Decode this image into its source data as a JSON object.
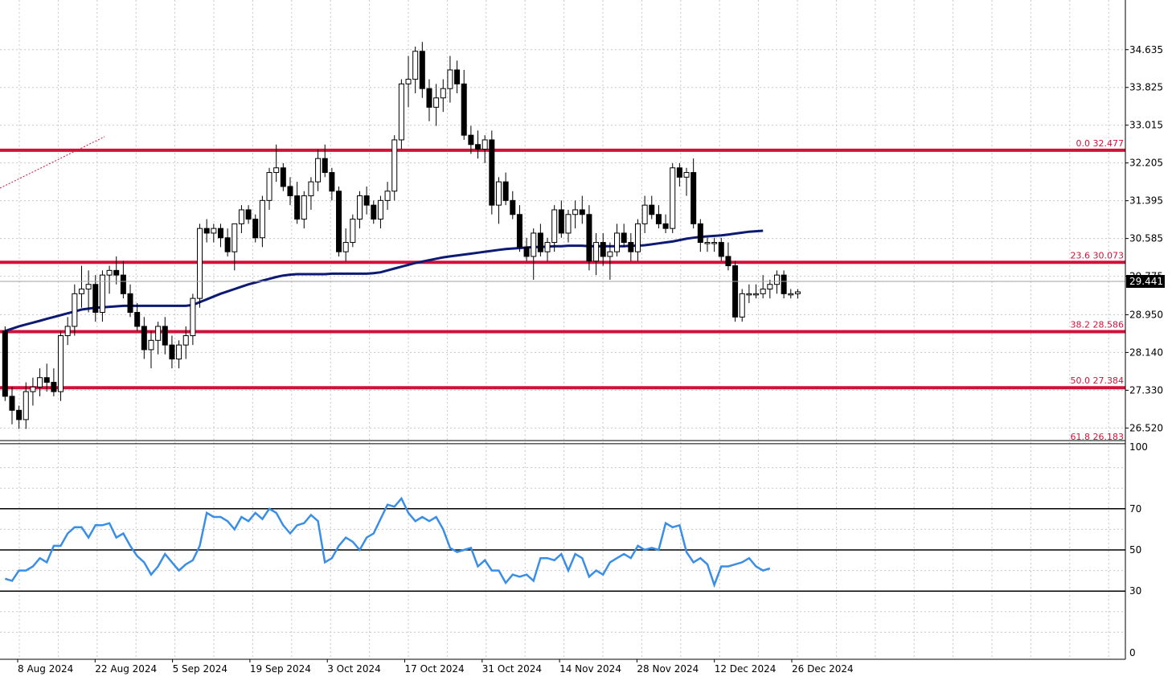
{
  "colors": {
    "background": "#ffffff",
    "grid": "#c8c8c8",
    "candle_up": "#ffffff",
    "candle_down": "#000000",
    "candle_outline": "#000000",
    "fib_line": "#d0123a",
    "moving_average": "#0c1a73",
    "rsi_line": "#3a8ee6",
    "rsi_levels": "#000000",
    "price_label_bg": "#000000",
    "price_label_text": "#ffffff",
    "axis_text": "#000000"
  },
  "chart_data": [
    {
      "type": "candlestick",
      "panel": "price",
      "price_axis_ticks": [
        "34.635",
        "33.825",
        "33.015",
        "32.205",
        "31.395",
        "30.585",
        "29.775",
        "28.950",
        "28.140",
        "27.330",
        "26.520"
      ],
      "ylim": [
        26.25,
        35.7
      ],
      "current_price": "29.441",
      "grid": true,
      "fibonacci_levels": [
        {
          "label": "0.0 32.477",
          "value": 32.477
        },
        {
          "label": "23.6 30.073",
          "value": 30.073
        },
        {
          "label": "38.2 28.586",
          "value": 28.586
        },
        {
          "label": "50.0 27.384",
          "value": 27.384
        },
        {
          "label": "61.8 26.183",
          "value": 26.183
        }
      ],
      "candles": [
        {
          "o": 28.6,
          "h": 28.7,
          "l": 27.1,
          "c": 27.2
        },
        {
          "o": 27.2,
          "h": 27.4,
          "l": 26.6,
          "c": 26.9
        },
        {
          "o": 26.9,
          "h": 27.0,
          "l": 26.5,
          "c": 26.7
        },
        {
          "o": 26.7,
          "h": 27.5,
          "l": 26.5,
          "c": 27.3
        },
        {
          "o": 27.3,
          "h": 27.6,
          "l": 27.0,
          "c": 27.4
        },
        {
          "o": 27.4,
          "h": 27.8,
          "l": 27.2,
          "c": 27.6
        },
        {
          "o": 27.6,
          "h": 27.9,
          "l": 27.3,
          "c": 27.5
        },
        {
          "o": 27.5,
          "h": 27.8,
          "l": 27.2,
          "c": 27.3
        },
        {
          "o": 27.3,
          "h": 28.6,
          "l": 27.1,
          "c": 28.5
        },
        {
          "o": 28.5,
          "h": 28.9,
          "l": 28.3,
          "c": 28.7
        },
        {
          "o": 28.7,
          "h": 29.6,
          "l": 28.5,
          "c": 29.4
        },
        {
          "o": 29.4,
          "h": 30.0,
          "l": 29.1,
          "c": 29.5
        },
        {
          "o": 29.5,
          "h": 29.9,
          "l": 29.0,
          "c": 29.6
        },
        {
          "o": 29.6,
          "h": 29.8,
          "l": 28.8,
          "c": 29.0
        },
        {
          "o": 29.0,
          "h": 29.9,
          "l": 28.8,
          "c": 29.8
        },
        {
          "o": 29.8,
          "h": 30.0,
          "l": 29.4,
          "c": 29.9
        },
        {
          "o": 29.9,
          "h": 30.2,
          "l": 29.6,
          "c": 29.8
        },
        {
          "o": 29.8,
          "h": 30.1,
          "l": 29.3,
          "c": 29.4
        },
        {
          "o": 29.4,
          "h": 29.6,
          "l": 28.9,
          "c": 29.0
        },
        {
          "o": 29.0,
          "h": 29.2,
          "l": 28.6,
          "c": 28.7
        },
        {
          "o": 28.7,
          "h": 28.9,
          "l": 28.0,
          "c": 28.2
        },
        {
          "o": 28.2,
          "h": 28.6,
          "l": 27.8,
          "c": 28.4
        },
        {
          "o": 28.4,
          "h": 28.8,
          "l": 28.1,
          "c": 28.7
        },
        {
          "o": 28.7,
          "h": 28.9,
          "l": 28.1,
          "c": 28.3
        },
        {
          "o": 28.3,
          "h": 28.5,
          "l": 27.8,
          "c": 28.0
        },
        {
          "o": 28.0,
          "h": 28.4,
          "l": 27.8,
          "c": 28.3
        },
        {
          "o": 28.3,
          "h": 28.7,
          "l": 28.0,
          "c": 28.5
        },
        {
          "o": 28.5,
          "h": 29.4,
          "l": 28.3,
          "c": 29.3
        },
        {
          "o": 29.3,
          "h": 30.9,
          "l": 29.1,
          "c": 30.8
        },
        {
          "o": 30.8,
          "h": 31.0,
          "l": 30.5,
          "c": 30.7
        },
        {
          "o": 30.7,
          "h": 30.9,
          "l": 30.5,
          "c": 30.8
        },
        {
          "o": 30.8,
          "h": 30.9,
          "l": 30.4,
          "c": 30.6
        },
        {
          "o": 30.6,
          "h": 30.8,
          "l": 30.2,
          "c": 30.3
        },
        {
          "o": 30.3,
          "h": 30.9,
          "l": 29.9,
          "c": 30.9
        },
        {
          "o": 30.9,
          "h": 31.3,
          "l": 30.7,
          "c": 31.2
        },
        {
          "o": 31.2,
          "h": 31.3,
          "l": 30.9,
          "c": 31.0
        },
        {
          "o": 31.0,
          "h": 31.1,
          "l": 30.5,
          "c": 30.6
        },
        {
          "o": 30.6,
          "h": 31.5,
          "l": 30.4,
          "c": 31.4
        },
        {
          "o": 31.4,
          "h": 32.1,
          "l": 31.2,
          "c": 32.0
        },
        {
          "o": 32.0,
          "h": 32.6,
          "l": 31.8,
          "c": 32.1
        },
        {
          "o": 32.1,
          "h": 32.2,
          "l": 31.6,
          "c": 31.7
        },
        {
          "o": 31.7,
          "h": 31.9,
          "l": 31.3,
          "c": 31.5
        },
        {
          "o": 31.5,
          "h": 31.8,
          "l": 30.9,
          "c": 31.0
        },
        {
          "o": 31.0,
          "h": 31.6,
          "l": 30.8,
          "c": 31.5
        },
        {
          "o": 31.5,
          "h": 31.9,
          "l": 31.2,
          "c": 31.8
        },
        {
          "o": 31.8,
          "h": 32.5,
          "l": 31.6,
          "c": 32.3
        },
        {
          "o": 32.3,
          "h": 32.6,
          "l": 31.9,
          "c": 32.0
        },
        {
          "o": 32.0,
          "h": 32.1,
          "l": 31.4,
          "c": 31.6
        },
        {
          "o": 31.6,
          "h": 31.7,
          "l": 30.2,
          "c": 30.3
        },
        {
          "o": 30.3,
          "h": 30.8,
          "l": 30.1,
          "c": 30.5
        },
        {
          "o": 30.5,
          "h": 31.1,
          "l": 30.4,
          "c": 31.0
        },
        {
          "o": 31.0,
          "h": 31.6,
          "l": 30.8,
          "c": 31.5
        },
        {
          "o": 31.5,
          "h": 31.7,
          "l": 31.1,
          "c": 31.3
        },
        {
          "o": 31.3,
          "h": 31.4,
          "l": 30.9,
          "c": 31.0
        },
        {
          "o": 31.0,
          "h": 31.5,
          "l": 30.8,
          "c": 31.4
        },
        {
          "o": 31.4,
          "h": 31.8,
          "l": 31.2,
          "c": 31.6
        },
        {
          "o": 31.6,
          "h": 32.8,
          "l": 31.4,
          "c": 32.7
        },
        {
          "o": 32.7,
          "h": 34.0,
          "l": 32.5,
          "c": 33.9
        },
        {
          "o": 33.9,
          "h": 34.5,
          "l": 33.4,
          "c": 34.0
        },
        {
          "o": 34.0,
          "h": 34.7,
          "l": 33.7,
          "c": 34.6
        },
        {
          "o": 34.6,
          "h": 34.8,
          "l": 33.6,
          "c": 33.8
        },
        {
          "o": 33.8,
          "h": 34.0,
          "l": 33.1,
          "c": 33.4
        },
        {
          "o": 33.4,
          "h": 33.9,
          "l": 33.0,
          "c": 33.6
        },
        {
          "o": 33.6,
          "h": 34.0,
          "l": 33.3,
          "c": 33.8
        },
        {
          "o": 33.8,
          "h": 34.5,
          "l": 33.5,
          "c": 34.2
        },
        {
          "o": 34.2,
          "h": 34.4,
          "l": 33.7,
          "c": 33.9
        },
        {
          "o": 33.9,
          "h": 34.2,
          "l": 32.7,
          "c": 32.8
        },
        {
          "o": 32.8,
          "h": 33.0,
          "l": 32.4,
          "c": 32.6
        },
        {
          "o": 32.6,
          "h": 32.9,
          "l": 32.3,
          "c": 32.5
        },
        {
          "o": 32.5,
          "h": 32.8,
          "l": 32.2,
          "c": 32.7
        },
        {
          "o": 32.7,
          "h": 32.9,
          "l": 31.1,
          "c": 31.3
        },
        {
          "o": 31.3,
          "h": 31.9,
          "l": 30.9,
          "c": 31.8
        },
        {
          "o": 31.8,
          "h": 32.0,
          "l": 31.3,
          "c": 31.4
        },
        {
          "o": 31.4,
          "h": 31.6,
          "l": 31.0,
          "c": 31.1
        },
        {
          "o": 31.1,
          "h": 31.3,
          "l": 30.3,
          "c": 30.4
        },
        {
          "o": 30.4,
          "h": 30.6,
          "l": 30.1,
          "c": 30.2
        },
        {
          "o": 30.2,
          "h": 30.8,
          "l": 29.7,
          "c": 30.7
        },
        {
          "o": 30.7,
          "h": 30.9,
          "l": 30.2,
          "c": 30.3
        },
        {
          "o": 30.3,
          "h": 30.6,
          "l": 30.1,
          "c": 30.5
        },
        {
          "o": 30.5,
          "h": 31.3,
          "l": 30.3,
          "c": 31.2
        },
        {
          "o": 31.2,
          "h": 31.4,
          "l": 30.6,
          "c": 30.7
        },
        {
          "o": 30.7,
          "h": 31.2,
          "l": 30.5,
          "c": 31.1
        },
        {
          "o": 31.1,
          "h": 31.4,
          "l": 30.8,
          "c": 31.2
        },
        {
          "o": 31.2,
          "h": 31.5,
          "l": 30.9,
          "c": 31.1
        },
        {
          "o": 31.1,
          "h": 31.3,
          "l": 29.9,
          "c": 30.1
        },
        {
          "o": 30.1,
          "h": 30.7,
          "l": 29.8,
          "c": 30.5
        },
        {
          "o": 30.5,
          "h": 30.7,
          "l": 30.0,
          "c": 30.2
        },
        {
          "o": 30.2,
          "h": 30.5,
          "l": 29.7,
          "c": 30.3
        },
        {
          "o": 30.3,
          "h": 30.9,
          "l": 30.2,
          "c": 30.7
        },
        {
          "o": 30.7,
          "h": 30.9,
          "l": 30.4,
          "c": 30.5
        },
        {
          "o": 30.5,
          "h": 30.7,
          "l": 30.1,
          "c": 30.3
        },
        {
          "o": 30.3,
          "h": 31.0,
          "l": 30.1,
          "c": 30.9
        },
        {
          "o": 30.9,
          "h": 31.5,
          "l": 30.7,
          "c": 31.3
        },
        {
          "o": 31.3,
          "h": 31.5,
          "l": 31.0,
          "c": 31.1
        },
        {
          "o": 31.1,
          "h": 31.3,
          "l": 30.8,
          "c": 30.9
        },
        {
          "o": 30.9,
          "h": 31.1,
          "l": 30.7,
          "c": 30.8
        },
        {
          "o": 30.8,
          "h": 32.2,
          "l": 30.7,
          "c": 32.1
        },
        {
          "o": 32.1,
          "h": 32.2,
          "l": 31.7,
          "c": 31.9
        },
        {
          "o": 31.9,
          "h": 32.1,
          "l": 31.5,
          "c": 32.0
        },
        {
          "o": 32.0,
          "h": 32.3,
          "l": 30.8,
          "c": 30.9
        },
        {
          "o": 30.9,
          "h": 31.0,
          "l": 30.3,
          "c": 30.5
        },
        {
          "o": 30.5,
          "h": 30.6,
          "l": 30.3,
          "c": 30.5
        },
        {
          "o": 30.5,
          "h": 30.6,
          "l": 30.3,
          "c": 30.5
        },
        {
          "o": 30.5,
          "h": 30.6,
          "l": 30.1,
          "c": 30.2
        },
        {
          "o": 30.2,
          "h": 30.5,
          "l": 29.9,
          "c": 30.0
        },
        {
          "o": 30.0,
          "h": 30.1,
          "l": 28.8,
          "c": 28.9
        },
        {
          "o": 28.9,
          "h": 29.5,
          "l": 28.8,
          "c": 29.4
        },
        {
          "o": 29.4,
          "h": 29.6,
          "l": 29.2,
          "c": 29.4
        },
        {
          "o": 29.4,
          "h": 29.6,
          "l": 29.3,
          "c": 29.4
        },
        {
          "o": 29.4,
          "h": 29.8,
          "l": 29.3,
          "c": 29.5
        },
        {
          "o": 29.5,
          "h": 29.7,
          "l": 29.3,
          "c": 29.6
        },
        {
          "o": 29.6,
          "h": 29.9,
          "l": 29.4,
          "c": 29.8
        },
        {
          "o": 29.8,
          "h": 29.9,
          "l": 29.3,
          "c": 29.4
        },
        {
          "o": 29.4,
          "h": 29.5,
          "l": 29.3,
          "c": 29.4
        },
        {
          "o": 29.4,
          "h": 29.5,
          "l": 29.3,
          "c": 29.44
        }
      ],
      "moving_average": [
        28.6,
        28.65,
        28.7,
        28.74,
        28.78,
        28.82,
        28.86,
        28.9,
        28.94,
        28.98,
        29.02,
        29.06,
        29.08,
        29.1,
        29.11,
        29.12,
        29.13,
        29.14,
        29.14,
        29.14,
        29.14,
        29.14,
        29.14,
        29.14,
        29.14,
        29.14,
        29.14,
        29.16,
        29.22,
        29.28,
        29.34,
        29.4,
        29.45,
        29.5,
        29.55,
        29.6,
        29.64,
        29.68,
        29.72,
        29.76,
        29.79,
        29.81,
        29.82,
        29.82,
        29.82,
        29.82,
        29.82,
        29.83,
        29.83,
        29.83,
        29.83,
        29.83,
        29.83,
        29.84,
        29.86,
        29.9,
        29.94,
        29.98,
        30.02,
        30.06,
        30.09,
        30.12,
        30.15,
        30.18,
        30.2,
        30.22,
        30.24,
        30.26,
        30.28,
        30.3,
        30.32,
        30.34,
        30.36,
        30.37,
        30.38,
        30.39,
        30.4,
        30.4,
        30.41,
        30.42,
        30.42,
        30.43,
        30.43,
        30.43,
        30.42,
        30.42,
        30.42,
        30.42,
        30.42,
        30.42,
        30.43,
        30.43,
        30.44,
        30.46,
        30.48,
        30.5,
        30.52,
        30.55,
        30.58,
        30.6,
        30.62,
        30.63,
        30.64,
        30.65,
        30.67,
        30.69,
        30.71,
        30.73,
        30.74,
        30.75
      ]
    },
    {
      "type": "line",
      "panel": "rsi",
      "axis_ticks": [
        "100",
        "70",
        "50",
        "30",
        "0"
      ],
      "levels": [
        70,
        50,
        30
      ],
      "ylim": [
        0,
        100
      ],
      "values": [
        36,
        35,
        40,
        40,
        42,
        46,
        44,
        52,
        52,
        58,
        61,
        61,
        56,
        62,
        62,
        63,
        56,
        58,
        52,
        47,
        44,
        38,
        42,
        48,
        44,
        40,
        43,
        45,
        52,
        68,
        66,
        66,
        64,
        60,
        66,
        64,
        68,
        65,
        70,
        68,
        62,
        58,
        62,
        63,
        67,
        64,
        44,
        46,
        52,
        56,
        54,
        50,
        56,
        58,
        65,
        72,
        71,
        75,
        68,
        64,
        66,
        64,
        66,
        60,
        51,
        49,
        50,
        51,
        42,
        45,
        40,
        40,
        34,
        38,
        37,
        38,
        35,
        46,
        46,
        45,
        48,
        40,
        48,
        46,
        37,
        40,
        38,
        44,
        46,
        48,
        46,
        52,
        50,
        51,
        50,
        63,
        61,
        62,
        49,
        44,
        46,
        43,
        33,
        42,
        42,
        43,
        44,
        46,
        42,
        40,
        41
      ]
    }
  ],
  "x_axis_labels": [
    "8 Aug 2024",
    "22 Aug 2024",
    "5 Sep 2024",
    "19 Sep 2024",
    "3 Oct 2024",
    "17 Oct 2024",
    "31 Oct 2024",
    "14 Nov 2024",
    "28 Nov 2024",
    "12 Dec 2024",
    "26 Dec 2024"
  ]
}
